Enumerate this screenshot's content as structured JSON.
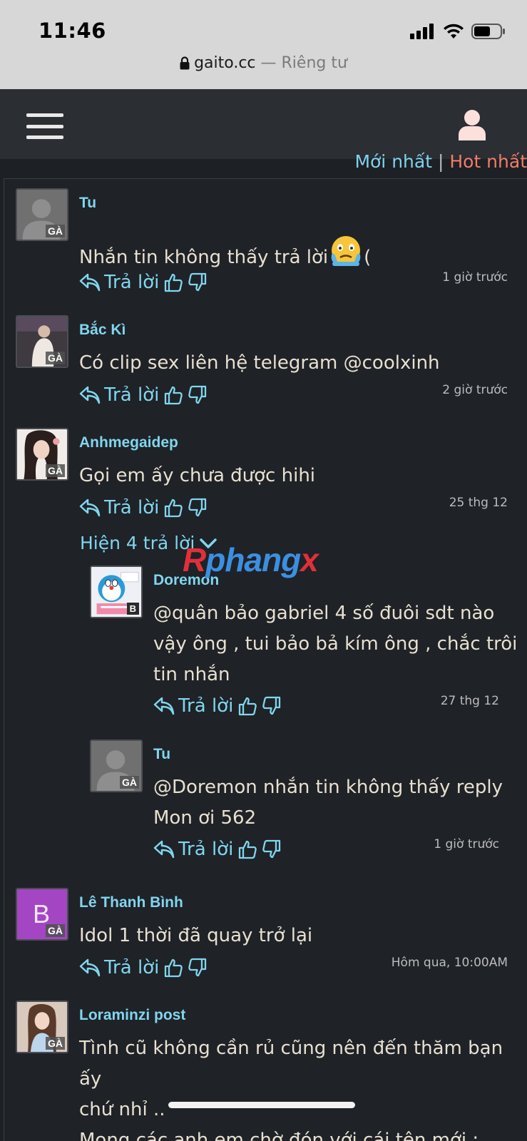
{
  "status_bar": {
    "time": "11:46"
  },
  "browser": {
    "domain": "gaito.cc",
    "mode": " — Riêng tư"
  },
  "sort": {
    "newest": "Mới nhất",
    "separator": " | ",
    "hot": "Hot nhất"
  },
  "comments": [
    {
      "user": "Tu",
      "badge": "GÀ",
      "text": "Nhắn tin không thấy trả lời",
      "text_suffix": "(",
      "reply": "Trả lời",
      "time": "1 giờ trước"
    },
    {
      "user": "Bắc Kì",
      "badge": "GÀ",
      "text": "Có clip sex liên hệ telegram @coolxinh",
      "reply": "Trả lời",
      "time": "2 giờ trước"
    },
    {
      "user": "Anhmegaidep",
      "badge": "GÀ",
      "text": "Gọi em ấy chưa được hihi",
      "reply": "Trả lời",
      "time": "25 thg 12"
    },
    {
      "user": "Lê Thanh Bình",
      "badge": "GÀ",
      "initial": "B",
      "text": "Idol 1 thời đã quay trở lại",
      "reply": "Trả lời",
      "time": "Hôm qua, 10:00AM"
    },
    {
      "user": "Loraminzi post",
      "badge": "GÀ",
      "text_lines": [
        "Tình cũ không cần rủ cũng nên đến thăm bạn ấy",
        "chứ nhỉ ..",
        "Mong các anh em chờ đón với cái tên mới :"
      ]
    }
  ],
  "show_replies": "Hiện 4 trả lời",
  "replies": [
    {
      "user": "Doremon",
      "badge": "B",
      "text_lines": [
        "@quân bảo gabriel 4 số đuôi sdt nào",
        "vậy ông , tui bảo bả kím ông , chắc trôi",
        "tin nhắn"
      ],
      "reply": "Trả lời",
      "time": "27 thg 12"
    },
    {
      "user": "Tu",
      "badge": "GÀ",
      "text_lines": [
        "@Doremon nhắn tin không thấy reply",
        "Mon ơi 562"
      ],
      "reply": "Trả lời",
      "time": "1 giờ trước"
    }
  ],
  "watermark": {
    "part1": "R",
    "part2": "phang",
    "part3": "x"
  },
  "colors": {
    "accent": "#80d6ee",
    "hot": "#f07d6a",
    "background": "#1f2227",
    "avatar_purple": "#a445c4"
  }
}
